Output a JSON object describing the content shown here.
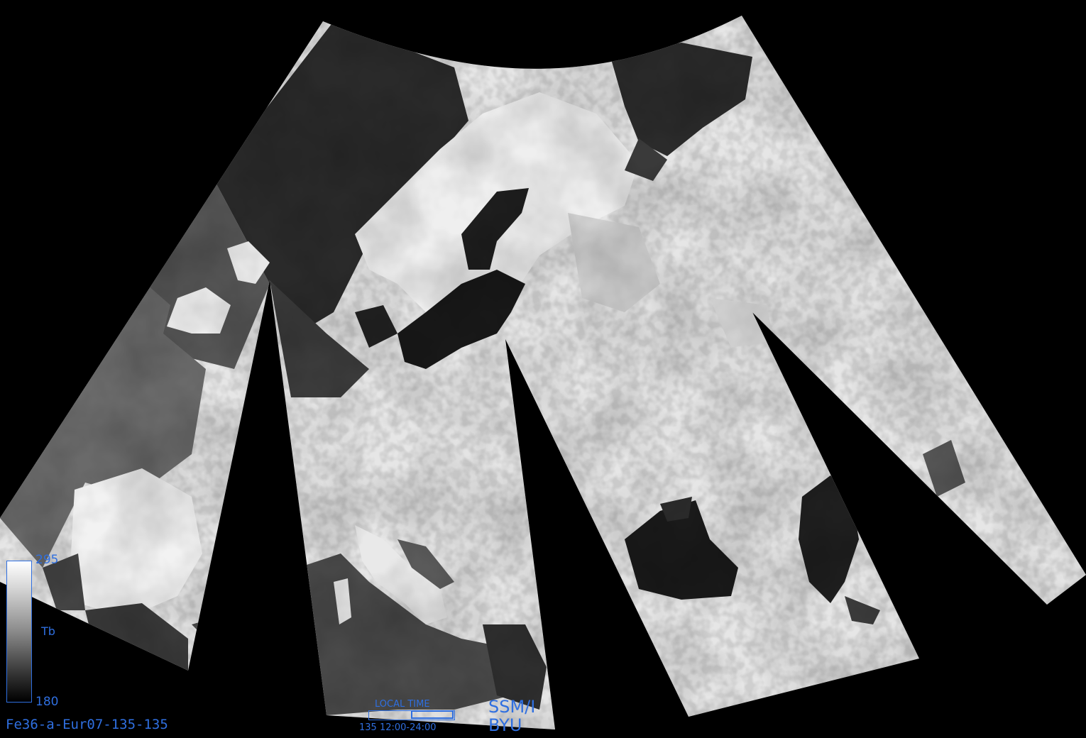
{
  "colorbar": {
    "max": "295",
    "min": "180",
    "label": "Tb",
    "colors": [
      "#ffffff",
      "#000000"
    ]
  },
  "product_id": "Fe36-a-Eur07-135-135",
  "local_time": {
    "title": "LOCAL TIME",
    "range_text": "135 12:00-24:00",
    "window_fraction": [
      0.5,
      1.0
    ]
  },
  "sensor": "SSM/I",
  "organization": "BYU",
  "theme": {
    "background": "#000000",
    "annotation_color": "#2f6fe0"
  }
}
